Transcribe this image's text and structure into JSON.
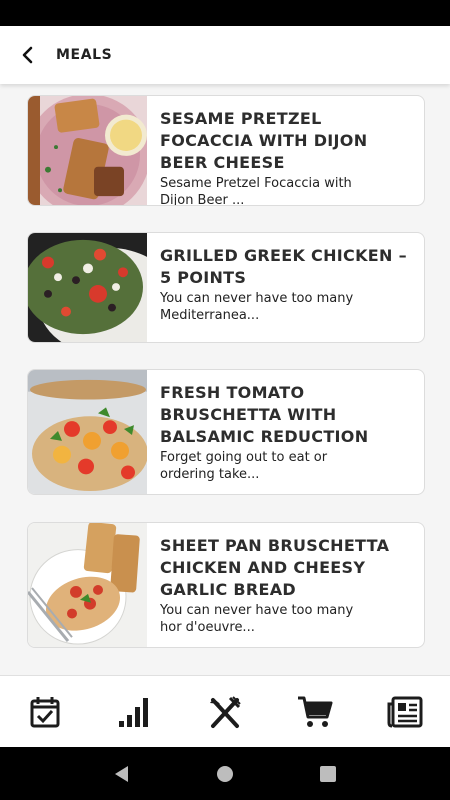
{
  "header": {
    "title": "MEALS"
  },
  "meals": [
    {
      "title": "Sesame Pretzel Focaccia with Dijon Beer Cheese",
      "description": "Sesame Pretzel Focaccia with Dijon Beer ..."
    },
    {
      "title": "Grilled Greek Chicken – 5 Points",
      "description": "You can never have too many Mediterranea..."
    },
    {
      "title": "Fresh Tomato Bruschetta with Balsamic Reduction",
      "description": "Forget going out to eat or ordering take..."
    },
    {
      "title": "Sheet Pan Bruschetta Chicken and Cheesy Garlic Bread",
      "description": "You can never have too many hor d'oeuvre..."
    }
  ],
  "bottom_nav": [
    "calendar-icon",
    "stats-icon",
    "meals-icon",
    "cart-icon",
    "news-icon"
  ],
  "colors": {
    "accent": "#2b2b2b",
    "background": "#f5f5f5"
  }
}
